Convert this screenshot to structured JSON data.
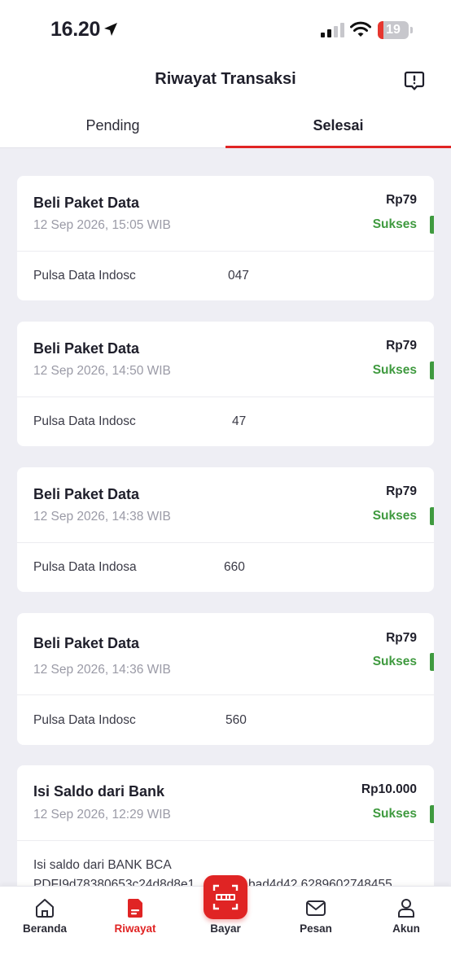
{
  "status_bar": {
    "time": "16.20",
    "battery_level": "19",
    "battery_fraction": 0.19
  },
  "header": {
    "title": "Riwayat Transaksi"
  },
  "tabs": [
    {
      "label": "Pending",
      "active": false
    },
    {
      "label": "Selesai",
      "active": true
    }
  ],
  "transactions": [
    {
      "title": "Beli Paket Data",
      "date": "12 Sep 2026, 15:05 WIB",
      "amount": "Rp79",
      "status": "Sukses",
      "description": "Pulsa Data Indosc",
      "description_tail": "047"
    },
    {
      "title": "Beli Paket Data",
      "date": "12 Sep 2026, 14:50 WIB",
      "amount": "Rp79",
      "status": "Sukses",
      "description": "Pulsa Data Indosc",
      "description_tail": "47"
    },
    {
      "title": "Beli Paket Data",
      "date": "12 Sep 2026, 14:38 WIB",
      "amount": "Rp79",
      "status": "Sukses",
      "description": "Pulsa Data Indosa",
      "description_tail": "660"
    },
    {
      "title": "Beli Paket Data",
      "date": "12 Sep 2026, 14:36 WIB",
      "amount": "Rp79",
      "status": "Sukses",
      "description": "Pulsa Data Indosc",
      "description_tail": "560"
    },
    {
      "title": "Isi Saldo dari Bank",
      "date": "12 Sep 2026, 12:29 WIB",
      "amount": "Rp10.000",
      "status": "Sukses",
      "description": "Isi saldo dari BANK BCA",
      "description_line2": "PDFI9d78380653c24d8d8e1",
      "description_line2_tail": "bad4d42 6289602748455"
    }
  ],
  "bottom_nav": [
    {
      "label": "Beranda",
      "icon": "home-icon",
      "active": false
    },
    {
      "label": "Riwayat",
      "icon": "history-icon",
      "active": true
    },
    {
      "label": "Bayar",
      "icon": "qris-icon",
      "active": false
    },
    {
      "label": "Pesan",
      "icon": "mail-icon",
      "active": false
    },
    {
      "label": "Akun",
      "icon": "account-icon",
      "active": false
    }
  ],
  "colors": {
    "accent": "#e02424",
    "success": "#3f9a3f",
    "background": "#eeeef4"
  }
}
